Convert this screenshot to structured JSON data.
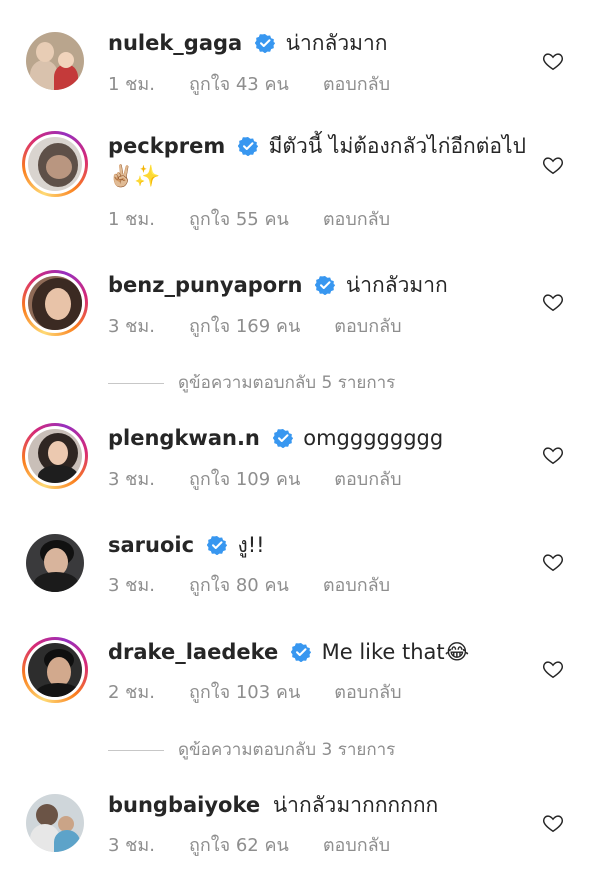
{
  "comments": [
    {
      "username": "nulek_gaga",
      "text": "น่ากลัวมาก",
      "time": "1 ชม.",
      "likes": "ถูกใจ 43 คน",
      "reply": "ตอบกลับ",
      "verified": true
    },
    {
      "username": "peckprem",
      "text": "มีตัวนี้ ไม่ต้องกลัวไก่อีกต่อไป ✌🏼✨",
      "time": "1 ชม.",
      "likes": "ถูกใจ 55 คน",
      "reply": "ตอบกลับ",
      "verified": true
    },
    {
      "username": "benz_punyaporn",
      "text": "น่ากลัวมาก",
      "time": "3 ชม.",
      "likes": "ถูกใจ 169 คน",
      "reply": "ตอบกลับ",
      "verified": true
    },
    {
      "username": "plengkwan.n",
      "text": "omgggggggg",
      "time": "3 ชม.",
      "likes": "ถูกใจ 109 คน",
      "reply": "ตอบกลับ",
      "verified": true
    },
    {
      "username": "saruoic",
      "text": "งู!!",
      "time": "3 ชม.",
      "likes": "ถูกใจ 80 คน",
      "reply": "ตอบกลับ",
      "verified": true
    },
    {
      "username": "drake_laedeke",
      "text": "Me like that😂",
      "time": "2 ชม.",
      "likes": "ถูกใจ 103 คน",
      "reply": "ตอบกลับ",
      "verified": true
    },
    {
      "username": "bungbaiyoke",
      "text": "น่ากลัวมากกกกกก",
      "time": "3 ชม.",
      "likes": "ถูกใจ 62 คน",
      "reply": "ตอบกลับ",
      "verified": false
    }
  ],
  "view_replies": [
    {
      "label": "ดูข้อความตอบกลับ 5 รายการ"
    },
    {
      "label": "ดูข้อความตอบกลับ 3 รายการ"
    }
  ],
  "colors": {
    "verified": "#3897f0",
    "meta": "#8e8e8e",
    "text": "#262626"
  }
}
